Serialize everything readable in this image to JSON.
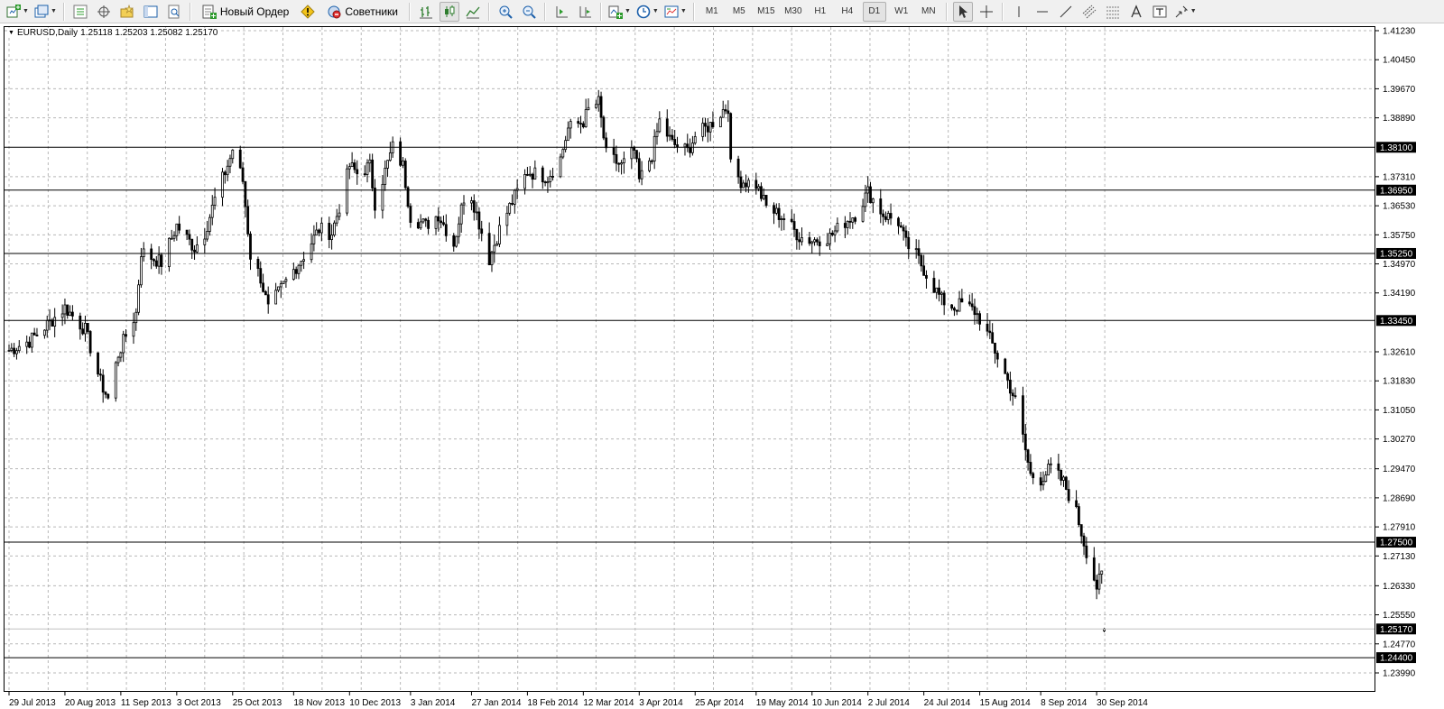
{
  "toolbar": {
    "new_order_label": "Новый Ордер",
    "advisors_label": "Советники",
    "timeframes": [
      "M1",
      "M5",
      "M15",
      "M30",
      "H1",
      "H4",
      "D1",
      "W1",
      "MN"
    ],
    "active_timeframe": "D1"
  },
  "chart": {
    "symbol_label": "EURUSD,Daily",
    "ohlc_label": "1.25118 1.25203 1.25082 1.25170"
  },
  "price_axis": {
    "ticks": [
      "1.41230",
      "1.40450",
      "1.39670",
      "1.38890",
      "1.37310",
      "1.36530",
      "1.35750",
      "1.34970",
      "1.34190",
      "1.32610",
      "1.31830",
      "1.31050",
      "1.30270",
      "1.29470",
      "1.28690",
      "1.27910",
      "1.27130",
      "1.26330",
      "1.25550",
      "1.24770",
      "1.23990"
    ],
    "level_labels": [
      "1.38100",
      "1.36950",
      "1.35250",
      "1.33450",
      "1.27500",
      "1.25170",
      "1.24400"
    ]
  },
  "time_axis": {
    "labels": [
      "29 Jul 2013",
      "20 Aug 2013",
      "11 Sep 2013",
      "3 Oct 2013",
      "25 Oct 2013",
      "18 Nov 2013",
      "10 Dec 2013",
      "3 Jan 2014",
      "27 Jan 2014",
      "18 Feb 2014",
      "12 Mar 2014",
      "3 Apr 2014",
      "25 Apr 2014",
      "19 May 2014",
      "10 Jun 2014",
      "2 Jul 2014",
      "24 Jul 2014",
      "15 Aug 2014",
      "8 Sep 2014",
      "30 Sep 2014"
    ]
  },
  "chart_data": {
    "type": "candlestick",
    "symbol": "EURUSD",
    "period": "Daily",
    "last": {
      "open": 1.25118,
      "high": 1.25203,
      "low": 1.25082,
      "close": 1.2517
    },
    "y_range": [
      1.2399,
      1.4123
    ],
    "x_range": [
      "2013-07-29",
      "2014-10-06"
    ],
    "grid": true,
    "horizontal_levels": [
      1.381,
      1.3695,
      1.3525,
      1.3345,
      1.275,
      1.244
    ],
    "current_price": 1.2517,
    "close_path": [
      [
        "2013-07-29",
        1.3265
      ],
      [
        "2013-08-06",
        1.329
      ],
      [
        "2013-08-14",
        1.334
      ],
      [
        "2013-08-20",
        1.338
      ],
      [
        "2013-08-28",
        1.332
      ],
      [
        "2013-09-03",
        1.318
      ],
      [
        "2013-09-06",
        1.3135
      ],
      [
        "2013-09-10",
        1.3255
      ],
      [
        "2013-09-13",
        1.3305
      ],
      [
        "2013-09-17",
        1.3365
      ],
      [
        "2013-09-19",
        1.353
      ],
      [
        "2013-09-27",
        1.35
      ],
      [
        "2013-10-03",
        1.36
      ],
      [
        "2013-10-10",
        1.354
      ],
      [
        "2013-10-14",
        1.358
      ],
      [
        "2013-10-18",
        1.367
      ],
      [
        "2013-10-24",
        1.378
      ],
      [
        "2013-10-25",
        1.3805
      ],
      [
        "2013-10-29",
        1.372
      ],
      [
        "2013-11-01",
        1.352
      ],
      [
        "2013-11-05",
        1.346
      ],
      [
        "2013-11-08",
        1.3375
      ],
      [
        "2013-11-14",
        1.344
      ],
      [
        "2013-11-18",
        1.348
      ],
      [
        "2013-11-22",
        1.352
      ],
      [
        "2013-11-28",
        1.359
      ],
      [
        "2013-12-03",
        1.358
      ],
      [
        "2013-12-06",
        1.365
      ],
      [
        "2013-12-10",
        1.376
      ],
      [
        "2013-12-13",
        1.374
      ],
      [
        "2013-12-18",
        1.376
      ],
      [
        "2013-12-20",
        1.366
      ],
      [
        "2013-12-27",
        1.381
      ],
      [
        "2013-12-31",
        1.376
      ],
      [
        "2014-01-03",
        1.3625
      ],
      [
        "2014-01-09",
        1.36
      ],
      [
        "2014-01-14",
        1.363
      ],
      [
        "2014-01-20",
        1.355
      ],
      [
        "2014-01-24",
        1.3675
      ],
      [
        "2014-01-27",
        1.368
      ],
      [
        "2014-02-03",
        1.351
      ],
      [
        "2014-02-07",
        1.359
      ],
      [
        "2014-02-11",
        1.365
      ],
      [
        "2014-02-18",
        1.3745
      ],
      [
        "2014-02-26",
        1.373
      ],
      [
        "2014-03-03",
        1.378
      ],
      [
        "2014-03-06",
        1.386
      ],
      [
        "2014-03-12",
        1.388
      ],
      [
        "2014-03-14",
        1.391
      ],
      [
        "2014-03-18",
        1.393
      ],
      [
        "2014-03-21",
        1.379
      ],
      [
        "2014-03-27",
        1.376
      ],
      [
        "2014-04-01",
        1.38
      ],
      [
        "2014-04-03",
        1.372
      ],
      [
        "2014-04-08",
        1.379
      ],
      [
        "2014-04-11",
        1.388
      ],
      [
        "2014-04-16",
        1.382
      ],
      [
        "2014-04-22",
        1.38
      ],
      [
        "2014-04-25",
        1.384
      ],
      [
        "2014-05-01",
        1.387
      ],
      [
        "2014-05-06",
        1.391
      ],
      [
        "2014-05-08",
        1.392
      ],
      [
        "2014-05-09",
        1.376
      ],
      [
        "2014-05-13",
        1.372
      ],
      [
        "2014-05-19",
        1.371
      ],
      [
        "2014-05-23",
        1.365
      ],
      [
        "2014-05-30",
        1.362
      ],
      [
        "2014-06-05",
        1.357
      ],
      [
        "2014-06-10",
        1.356
      ],
      [
        "2014-06-17",
        1.357
      ],
      [
        "2014-06-23",
        1.361
      ],
      [
        "2014-06-27",
        1.363
      ],
      [
        "2014-07-02",
        1.369
      ],
      [
        "2014-07-08",
        1.363
      ],
      [
        "2014-07-14",
        1.361
      ],
      [
        "2014-07-17",
        1.355
      ],
      [
        "2014-07-21",
        1.352
      ],
      [
        "2014-07-25",
        1.347
      ],
      [
        "2014-07-31",
        1.34
      ],
      [
        "2014-08-05",
        1.338
      ],
      [
        "2014-08-08",
        1.339
      ],
      [
        "2014-08-13",
        1.337
      ],
      [
        "2014-08-15",
        1.335
      ],
      [
        "2014-08-20",
        1.328
      ],
      [
        "2014-08-25",
        1.32
      ],
      [
        "2014-08-29",
        1.313
      ],
      [
        "2014-09-04",
        1.293
      ],
      [
        "2014-09-08",
        1.292
      ],
      [
        "2014-09-12",
        1.295
      ],
      [
        "2014-09-17",
        1.291
      ],
      [
        "2014-09-22",
        1.283
      ],
      [
        "2014-09-25",
        1.275
      ],
      [
        "2014-09-30",
        1.263
      ],
      [
        "2014-10-02",
        1.266
      ],
      [
        "2014-10-03",
        1.2517
      ]
    ]
  }
}
